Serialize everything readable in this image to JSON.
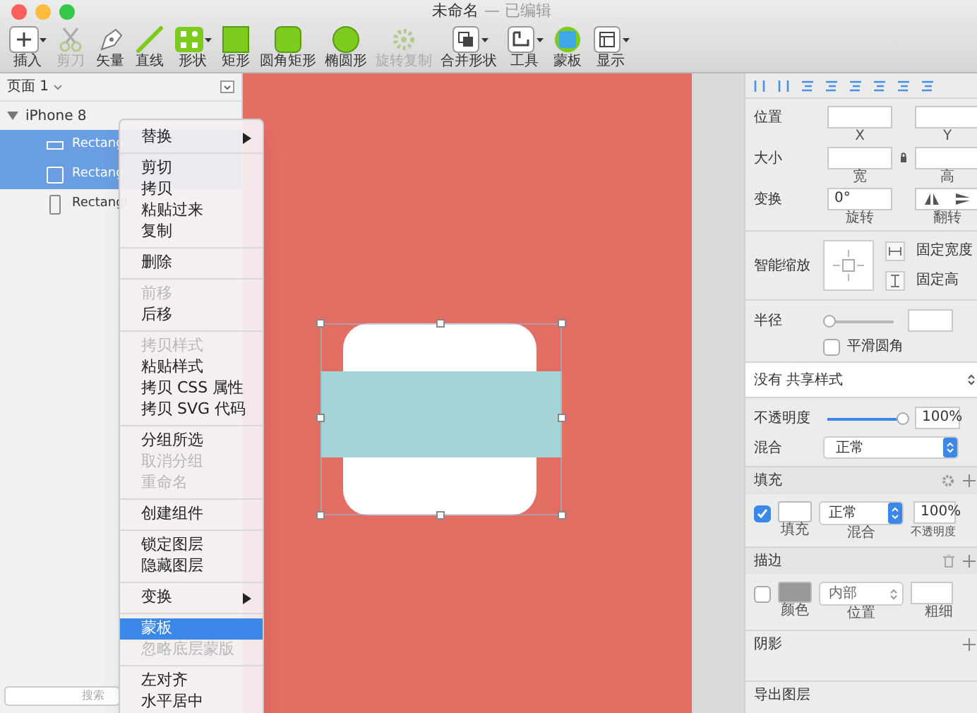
{
  "window": {
    "title": "未命名",
    "subtitle": "— 已编辑"
  },
  "toolbar": [
    {
      "label": "插入",
      "kind": "insert",
      "dropdown": true,
      "disabled": false
    },
    {
      "label": "剪刀",
      "kind": "scissors",
      "dropdown": false,
      "disabled": true
    },
    {
      "label": "矢量",
      "kind": "pen",
      "dropdown": false,
      "disabled": false
    },
    {
      "label": "直线",
      "kind": "line",
      "dropdown": false,
      "disabled": false
    },
    {
      "label": "形状",
      "kind": "shapes",
      "dropdown": true,
      "disabled": false
    },
    {
      "label": "矩形",
      "kind": "rect",
      "dropdown": false,
      "disabled": false
    },
    {
      "label": "圆角矩形",
      "kind": "rounded",
      "dropdown": false,
      "disabled": false
    },
    {
      "label": "椭圆形",
      "kind": "oval",
      "dropdown": false,
      "disabled": false
    },
    {
      "label": "旋转复制",
      "kind": "rotate",
      "dropdown": false,
      "disabled": true
    },
    {
      "label": "合并形状",
      "kind": "combine",
      "dropdown": true,
      "disabled": false
    },
    {
      "label": "工具",
      "kind": "tools",
      "dropdown": true,
      "disabled": false
    },
    {
      "label": "蒙板",
      "kind": "mask",
      "dropdown": false,
      "disabled": false
    },
    {
      "label": "显示",
      "kind": "view",
      "dropdown": true,
      "disabled": false
    }
  ],
  "layers": {
    "page": "页面 1",
    "artboard": {
      "name": "iPhone 8",
      "expanded": true,
      "children": [
        {
          "name": "Rectang",
          "kind": "line",
          "selected": true
        },
        {
          "name": "Rectang",
          "kind": "square",
          "selected": true
        },
        {
          "name": "Rectangl",
          "kind": "tall",
          "selected": false
        }
      ]
    },
    "search": {
      "placeholder": "搜索"
    }
  },
  "context_menu": [
    [
      {
        "label": "替换",
        "disabled": false,
        "selected": false,
        "submenu": true
      }
    ],
    [
      {
        "label": "剪切",
        "disabled": false,
        "selected": false,
        "submenu": false
      },
      {
        "label": "拷贝",
        "disabled": false,
        "selected": false,
        "submenu": false
      },
      {
        "label": "粘贴过来",
        "disabled": false,
        "selected": false,
        "submenu": false
      },
      {
        "label": "复制",
        "disabled": false,
        "selected": false,
        "submenu": false
      }
    ],
    [
      {
        "label": "删除",
        "disabled": false,
        "selected": false,
        "submenu": false
      }
    ],
    [
      {
        "label": "前移",
        "disabled": true,
        "selected": false,
        "submenu": false
      },
      {
        "label": "后移",
        "disabled": false,
        "selected": false,
        "submenu": false
      }
    ],
    [
      {
        "label": "拷贝样式",
        "disabled": true,
        "selected": false,
        "submenu": false
      },
      {
        "label": "粘贴样式",
        "disabled": false,
        "selected": false,
        "submenu": false
      },
      {
        "label": "拷贝 CSS 属性",
        "disabled": false,
        "selected": false,
        "submenu": false
      },
      {
        "label": "拷贝 SVG 代码",
        "disabled": false,
        "selected": false,
        "submenu": false
      }
    ],
    [
      {
        "label": "分组所选",
        "disabled": false,
        "selected": false,
        "submenu": false
      },
      {
        "label": "取消分组",
        "disabled": true,
        "selected": false,
        "submenu": false
      },
      {
        "label": "重命名",
        "disabled": true,
        "selected": false,
        "submenu": false
      }
    ],
    [
      {
        "label": "创建组件",
        "disabled": false,
        "selected": false,
        "submenu": false
      }
    ],
    [
      {
        "label": "锁定图层",
        "disabled": false,
        "selected": false,
        "submenu": false
      },
      {
        "label": "隐藏图层",
        "disabled": false,
        "selected": false,
        "submenu": false
      }
    ],
    [
      {
        "label": "变换",
        "disabled": false,
        "selected": false,
        "submenu": true
      }
    ],
    [
      {
        "label": "蒙板",
        "disabled": false,
        "selected": true,
        "submenu": false
      },
      {
        "label": "忽略底层蒙版",
        "disabled": true,
        "selected": false,
        "submenu": false
      }
    ],
    [
      {
        "label": "左对齐",
        "disabled": false,
        "selected": false,
        "submenu": false
      },
      {
        "label": "水平居中",
        "disabled": false,
        "selected": false,
        "submenu": false
      }
    ]
  ],
  "inspector": {
    "position": {
      "label": "位置",
      "captions": [
        "X",
        "Y"
      ]
    },
    "size": {
      "label": "大小",
      "captions": [
        "宽",
        "高"
      ]
    },
    "transform": {
      "label": "变换",
      "rotate": "0°",
      "rotate_caption": "旋转",
      "flip_caption": "翻转"
    },
    "resizing": {
      "label": "智能缩放",
      "options": [
        "固定宽度",
        "固定高"
      ]
    },
    "radius": {
      "label": "半径",
      "level": 0,
      "smooth_label": "平滑圆角",
      "smooth_checked": false
    },
    "shared_style": "没有 共享样式",
    "opacity": {
      "label": "不透明度",
      "level": 1,
      "value": "100%"
    },
    "blend": {
      "label": "混合",
      "value": "正常"
    },
    "fills": {
      "title": "填充",
      "enabled": true,
      "blend": "正常",
      "opacity": "100%",
      "captions": [
        "填充",
        "混合",
        "不透明度"
      ]
    },
    "borders": {
      "title": "描边",
      "enabled": false,
      "position": "内部",
      "captions": [
        "颜色",
        "位置",
        "粗细"
      ]
    },
    "shadows": {
      "title": "阴影"
    },
    "export": {
      "title": "导出图层"
    }
  }
}
